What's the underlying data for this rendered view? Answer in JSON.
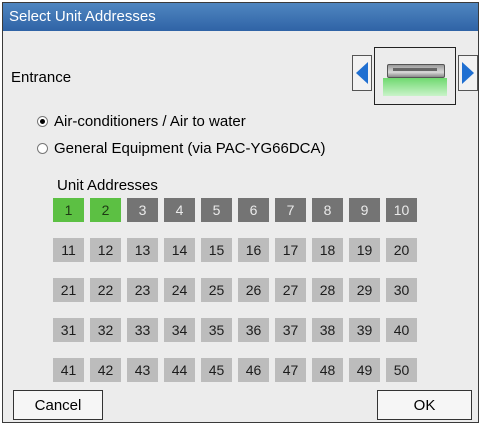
{
  "window": {
    "title": "Select Unit Addresses"
  },
  "entrance": {
    "label": "Entrance",
    "unit_icon": "indoor-unit-ceiling-cassette-icon",
    "prev_icon": "arrow-left-icon",
    "next_icon": "arrow-right-icon"
  },
  "unit_type": {
    "options": [
      {
        "label": "Air-conditioners / Air to water",
        "selected": true
      },
      {
        "label": "General Equipment (via PAC-YG66DCA)",
        "selected": false
      }
    ]
  },
  "unit_addresses": {
    "label": "Unit Addresses",
    "cells": [
      {
        "value": "1",
        "state": "selected"
      },
      {
        "value": "2",
        "state": "selected"
      },
      {
        "value": "3",
        "state": "registered"
      },
      {
        "value": "4",
        "state": "registered"
      },
      {
        "value": "5",
        "state": "registered"
      },
      {
        "value": "6",
        "state": "registered"
      },
      {
        "value": "7",
        "state": "registered"
      },
      {
        "value": "8",
        "state": "registered"
      },
      {
        "value": "9",
        "state": "registered"
      },
      {
        "value": "10",
        "state": "registered"
      },
      {
        "value": "11",
        "state": "available"
      },
      {
        "value": "12",
        "state": "available"
      },
      {
        "value": "13",
        "state": "available"
      },
      {
        "value": "14",
        "state": "available"
      },
      {
        "value": "15",
        "state": "available"
      },
      {
        "value": "16",
        "state": "available"
      },
      {
        "value": "17",
        "state": "available"
      },
      {
        "value": "18",
        "state": "available"
      },
      {
        "value": "19",
        "state": "available"
      },
      {
        "value": "20",
        "state": "available"
      },
      {
        "value": "21",
        "state": "available"
      },
      {
        "value": "22",
        "state": "available"
      },
      {
        "value": "23",
        "state": "available"
      },
      {
        "value": "24",
        "state": "available"
      },
      {
        "value": "25",
        "state": "available"
      },
      {
        "value": "26",
        "state": "available"
      },
      {
        "value": "27",
        "state": "available"
      },
      {
        "value": "28",
        "state": "available"
      },
      {
        "value": "29",
        "state": "available"
      },
      {
        "value": "30",
        "state": "available"
      },
      {
        "value": "31",
        "state": "available"
      },
      {
        "value": "32",
        "state": "available"
      },
      {
        "value": "33",
        "state": "available"
      },
      {
        "value": "34",
        "state": "available"
      },
      {
        "value": "35",
        "state": "available"
      },
      {
        "value": "36",
        "state": "available"
      },
      {
        "value": "37",
        "state": "available"
      },
      {
        "value": "38",
        "state": "available"
      },
      {
        "value": "39",
        "state": "available"
      },
      {
        "value": "40",
        "state": "available"
      },
      {
        "value": "41",
        "state": "available"
      },
      {
        "value": "42",
        "state": "available"
      },
      {
        "value": "43",
        "state": "available"
      },
      {
        "value": "44",
        "state": "available"
      },
      {
        "value": "45",
        "state": "available"
      },
      {
        "value": "46",
        "state": "available"
      },
      {
        "value": "47",
        "state": "available"
      },
      {
        "value": "48",
        "state": "available"
      },
      {
        "value": "49",
        "state": "available"
      },
      {
        "value": "50",
        "state": "available"
      }
    ]
  },
  "buttons": {
    "cancel": "Cancel",
    "ok": "OK"
  },
  "colors": {
    "title_bar": "#2f63a6",
    "selected": "#5cc043",
    "registered": "#747474",
    "available": "#bcbcbc",
    "arrow": "#1f6fd1"
  }
}
